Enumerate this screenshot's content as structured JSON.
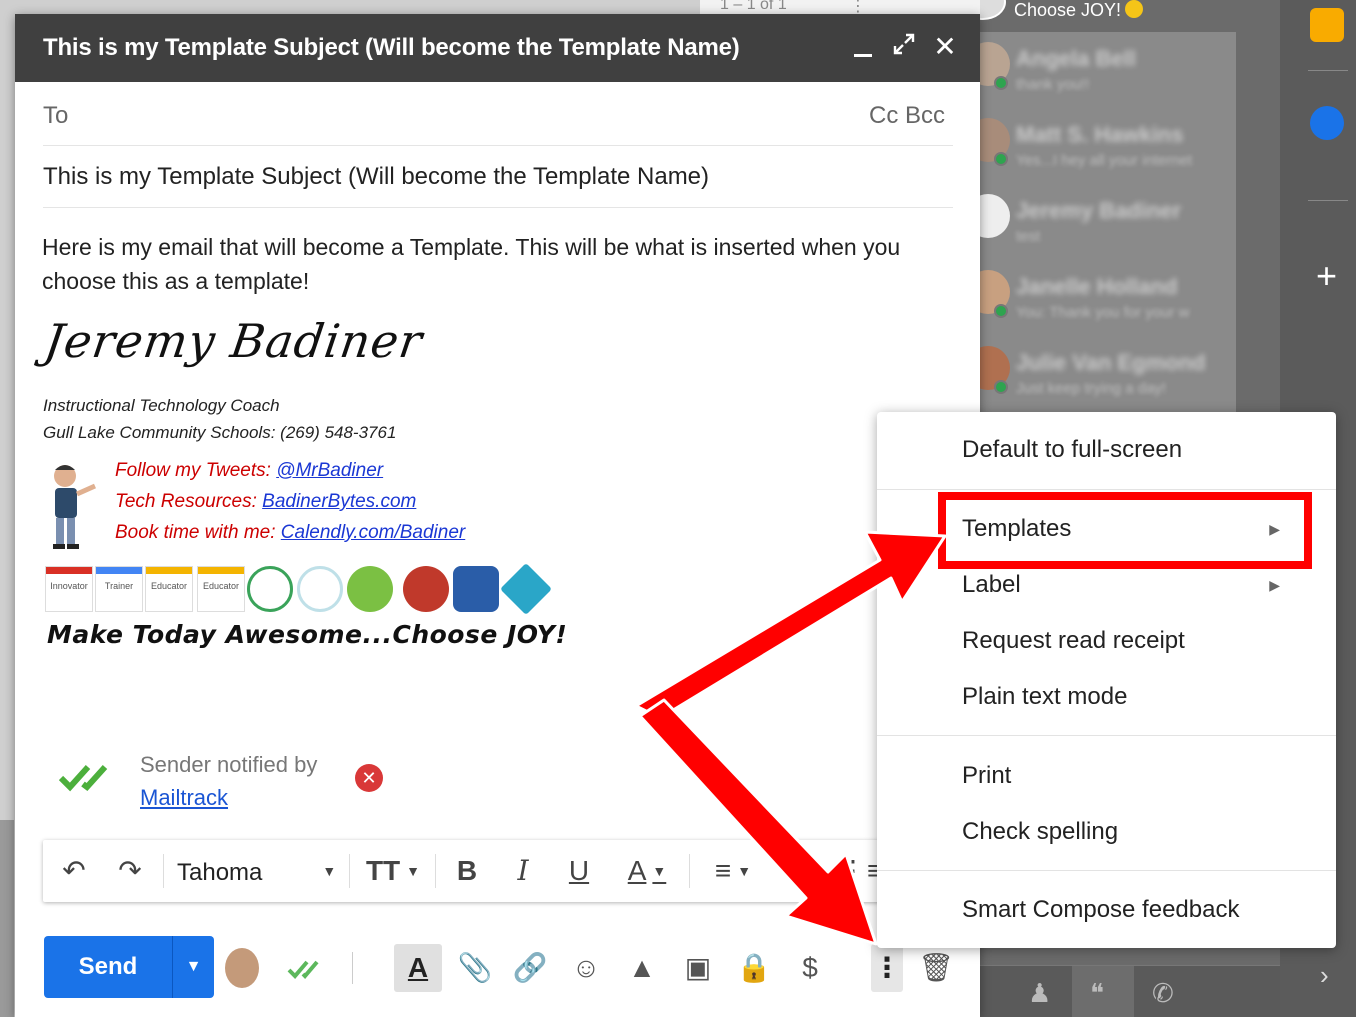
{
  "window": {
    "title": "This is my Template Subject (Will become the Template Name)"
  },
  "background": {
    "pager": "1 – 1 of 1",
    "chat_header": "Choose JOY!",
    "chat_contacts": [
      {
        "name": "Angela Bell",
        "message": "thank you!!"
      },
      {
        "name": "Matt S. Hawkins",
        "message": "Yes...I hey all your internet"
      },
      {
        "name": "Jeremy Badiner",
        "message": "test"
      },
      {
        "name": "Janelle Holland",
        "message": "You: Thank you for your w"
      },
      {
        "name": "Julie Van Egmond",
        "message": "Just keep trying a day!"
      }
    ]
  },
  "compose": {
    "to_label": "To",
    "cc_bcc": "Cc Bcc",
    "subject": "This is my Template Subject (Will become the Template Name)",
    "body": "Here is my email that will become a Template. This will be what is inserted when you choose this as a template!",
    "signature": {
      "name": "Jeremy Badiner",
      "title": "Instructional Technology Coach",
      "school": "Gull Lake Community Schools: (269) 548-3761",
      "links": [
        {
          "label": "Follow my Tweets:",
          "link": "@MrBadiner"
        },
        {
          "label": "Tech Resources:",
          "link": "BadinerBytes.com"
        },
        {
          "label": "Book time with me:",
          "link": "Calendly.com/Badiner"
        }
      ],
      "badges": [
        "Innovator",
        "Trainer",
        "Educator",
        "Educator"
      ],
      "motto": "Make Today Awesome...Choose JOY!"
    },
    "mailtrack": {
      "label": "Sender notified by",
      "link": "Mailtrack"
    },
    "toolbar": {
      "font": "Tahoma"
    },
    "send_label": "Send"
  },
  "menu": {
    "items": [
      "Default to full-screen",
      "Templates",
      "Label",
      "Request read receipt",
      "Plain text mode",
      "Print",
      "Check spelling",
      "Smart Compose feedback"
    ]
  },
  "colors": {
    "header": "#404040",
    "send": "#1a73e8",
    "annotation": "#ff0000",
    "link": "#1a37d4",
    "signature_red": "#cc0000"
  }
}
